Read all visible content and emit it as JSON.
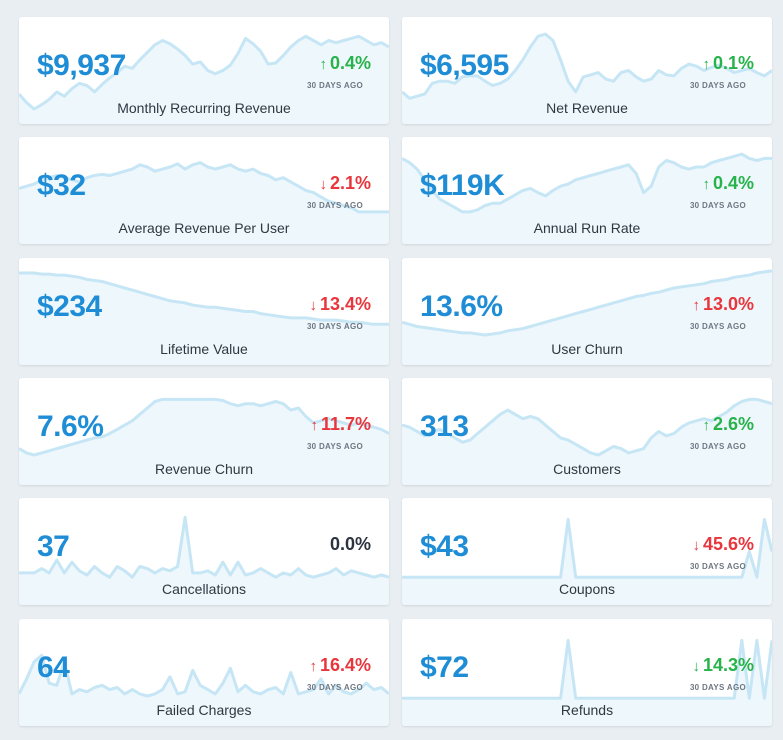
{
  "period_label": "30 DAYS AGO",
  "colors": {
    "value": "#1f8dd6",
    "positive": "#27b24a",
    "negative": "#e8363c",
    "neutral": "#2c3440",
    "spark_line": "#c6e6f5",
    "spark_fill": "#eef7fc"
  },
  "metrics": [
    {
      "title": "Monthly Recurring Revenue",
      "value": "$9,937",
      "change": "0.4%",
      "direction": "up",
      "status": "positive",
      "show_period": true,
      "trend": [
        0.72,
        0.8,
        0.86,
        0.82,
        0.77,
        0.7,
        0.74,
        0.67,
        0.62,
        0.64,
        0.7,
        0.63,
        0.57,
        0.52,
        0.46,
        0.48,
        0.4,
        0.33,
        0.26,
        0.22,
        0.25,
        0.3,
        0.36,
        0.44,
        0.42,
        0.5,
        0.53,
        0.5,
        0.45,
        0.34,
        0.2,
        0.25,
        0.32,
        0.44,
        0.43,
        0.36,
        0.28,
        0.22,
        0.18,
        0.22,
        0.26,
        0.22,
        0.24,
        0.22,
        0.2,
        0.18,
        0.22,
        0.26,
        0.24,
        0.28
      ]
    },
    {
      "title": "Net Revenue",
      "value": "$6,595",
      "change": "0.1%",
      "direction": "up",
      "status": "positive",
      "show_period": true,
      "trend": [
        0.7,
        0.76,
        0.74,
        0.72,
        0.62,
        0.6,
        0.6,
        0.62,
        0.56,
        0.55,
        0.55,
        0.6,
        0.64,
        0.62,
        0.58,
        0.5,
        0.4,
        0.28,
        0.18,
        0.16,
        0.22,
        0.4,
        0.6,
        0.7,
        0.56,
        0.54,
        0.52,
        0.58,
        0.6,
        0.52,
        0.5,
        0.56,
        0.6,
        0.58,
        0.5,
        0.54,
        0.55,
        0.48,
        0.44,
        0.46,
        0.5,
        0.47,
        0.45,
        0.48,
        0.52,
        0.5,
        0.48,
        0.52,
        0.55,
        0.5
      ]
    },
    {
      "title": "Average Revenue Per User",
      "value": "$32",
      "change": "2.1%",
      "direction": "down",
      "status": "negative",
      "show_period": true,
      "trend": [
        0.48,
        0.46,
        0.44,
        0.4,
        0.38,
        0.36,
        0.38,
        0.4,
        0.42,
        0.38,
        0.36,
        0.35,
        0.36,
        0.34,
        0.32,
        0.3,
        0.26,
        0.28,
        0.32,
        0.3,
        0.28,
        0.25,
        0.3,
        0.26,
        0.24,
        0.28,
        0.3,
        0.28,
        0.26,
        0.3,
        0.32,
        0.3,
        0.34,
        0.36,
        0.4,
        0.38,
        0.42,
        0.46,
        0.5,
        0.52,
        0.56,
        0.6,
        0.62,
        0.64,
        0.66,
        0.7,
        0.7,
        0.7,
        0.7,
        0.7
      ]
    },
    {
      "title": "Annual Run Rate",
      "value": "$119K",
      "change": "0.4%",
      "direction": "up",
      "status": "positive",
      "show_period": true,
      "trend": [
        0.2,
        0.24,
        0.3,
        0.4,
        0.5,
        0.58,
        0.62,
        0.66,
        0.7,
        0.7,
        0.68,
        0.64,
        0.62,
        0.62,
        0.58,
        0.54,
        0.5,
        0.48,
        0.52,
        0.55,
        0.5,
        0.46,
        0.44,
        0.4,
        0.38,
        0.36,
        0.34,
        0.32,
        0.3,
        0.28,
        0.26,
        0.34,
        0.52,
        0.46,
        0.28,
        0.22,
        0.24,
        0.28,
        0.3,
        0.28,
        0.28,
        0.24,
        0.22,
        0.2,
        0.18,
        0.16,
        0.2,
        0.22,
        0.2,
        0.2
      ]
    },
    {
      "title": "Lifetime Value",
      "value": "$234",
      "change": "13.4%",
      "direction": "down",
      "status": "negative",
      "show_period": true,
      "trend": [
        0.14,
        0.14,
        0.14,
        0.15,
        0.15,
        0.16,
        0.16,
        0.17,
        0.18,
        0.2,
        0.21,
        0.22,
        0.24,
        0.26,
        0.28,
        0.3,
        0.32,
        0.34,
        0.36,
        0.38,
        0.4,
        0.41,
        0.42,
        0.44,
        0.45,
        0.46,
        0.46,
        0.47,
        0.48,
        0.49,
        0.5,
        0.5,
        0.52,
        0.53,
        0.54,
        0.55,
        0.56,
        0.56,
        0.56,
        0.57,
        0.58,
        0.58,
        0.58,
        0.59,
        0.6,
        0.6,
        0.61,
        0.62,
        0.62,
        0.62
      ]
    },
    {
      "title": "User Churn",
      "value": "13.6%",
      "change": "13.0%",
      "direction": "up",
      "status": "negative",
      "show_period": true,
      "trend": [
        0.6,
        0.62,
        0.64,
        0.65,
        0.66,
        0.67,
        0.68,
        0.69,
        0.7,
        0.7,
        0.71,
        0.72,
        0.71,
        0.7,
        0.68,
        0.67,
        0.66,
        0.64,
        0.62,
        0.6,
        0.58,
        0.56,
        0.54,
        0.52,
        0.5,
        0.48,
        0.46,
        0.44,
        0.42,
        0.4,
        0.38,
        0.36,
        0.35,
        0.33,
        0.32,
        0.3,
        0.28,
        0.27,
        0.26,
        0.25,
        0.24,
        0.22,
        0.21,
        0.2,
        0.18,
        0.17,
        0.16,
        0.14,
        0.13,
        0.12
      ]
    },
    {
      "title": "Revenue Churn",
      "value": "7.6%",
      "change": "11.7%",
      "direction": "up",
      "status": "negative",
      "show_period": true,
      "trend": [
        0.66,
        0.7,
        0.72,
        0.7,
        0.68,
        0.66,
        0.64,
        0.62,
        0.6,
        0.58,
        0.56,
        0.55,
        0.52,
        0.48,
        0.44,
        0.4,
        0.34,
        0.28,
        0.22,
        0.2,
        0.2,
        0.2,
        0.2,
        0.2,
        0.2,
        0.2,
        0.2,
        0.21,
        0.24,
        0.26,
        0.24,
        0.24,
        0.26,
        0.24,
        0.22,
        0.24,
        0.3,
        0.28,
        0.36,
        0.42,
        0.4,
        0.38,
        0.4,
        0.42,
        0.44,
        0.42,
        0.44,
        0.46,
        0.48,
        0.52
      ]
    },
    {
      "title": "Customers",
      "value": "313",
      "change": "2.6%",
      "direction": "up",
      "status": "positive",
      "show_period": true,
      "trend": [
        0.44,
        0.46,
        0.5,
        0.54,
        0.5,
        0.48,
        0.52,
        0.56,
        0.6,
        0.58,
        0.52,
        0.46,
        0.4,
        0.34,
        0.3,
        0.34,
        0.38,
        0.36,
        0.38,
        0.44,
        0.5,
        0.56,
        0.58,
        0.62,
        0.66,
        0.7,
        0.72,
        0.68,
        0.64,
        0.66,
        0.7,
        0.68,
        0.66,
        0.56,
        0.5,
        0.54,
        0.52,
        0.46,
        0.42,
        0.4,
        0.38,
        0.4,
        0.36,
        0.32,
        0.26,
        0.22,
        0.2,
        0.2,
        0.22,
        0.24
      ]
    },
    {
      "title": "Cancellations",
      "value": "37",
      "change": "0.0%",
      "direction": "none",
      "status": "neutral",
      "show_period": false,
      "trend": [
        0.7,
        0.7,
        0.7,
        0.66,
        0.7,
        0.58,
        0.7,
        0.6,
        0.68,
        0.72,
        0.64,
        0.7,
        0.74,
        0.64,
        0.68,
        0.74,
        0.64,
        0.66,
        0.7,
        0.66,
        0.68,
        0.64,
        0.18,
        0.7,
        0.7,
        0.68,
        0.72,
        0.6,
        0.72,
        0.6,
        0.72,
        0.7,
        0.66,
        0.7,
        0.74,
        0.7,
        0.72,
        0.66,
        0.72,
        0.74,
        0.72,
        0.7,
        0.66,
        0.72,
        0.68,
        0.7,
        0.72,
        0.74,
        0.72,
        0.74
      ]
    },
    {
      "title": "Coupons",
      "value": "$43",
      "change": "45.6%",
      "direction": "down",
      "status": "negative",
      "show_period": true,
      "trend": [
        0.74,
        0.74,
        0.74,
        0.74,
        0.74,
        0.74,
        0.74,
        0.74,
        0.74,
        0.74,
        0.74,
        0.74,
        0.74,
        0.74,
        0.74,
        0.74,
        0.74,
        0.74,
        0.74,
        0.74,
        0.74,
        0.74,
        0.2,
        0.74,
        0.74,
        0.74,
        0.74,
        0.74,
        0.74,
        0.74,
        0.74,
        0.74,
        0.74,
        0.74,
        0.74,
        0.74,
        0.74,
        0.74,
        0.74,
        0.74,
        0.74,
        0.74,
        0.74,
        0.74,
        0.74,
        0.74,
        0.5,
        0.74,
        0.2,
        0.5
      ]
    },
    {
      "title": "Failed Charges",
      "value": "64",
      "change": "16.4%",
      "direction": "up",
      "status": "negative",
      "show_period": true,
      "trend": [
        0.7,
        0.56,
        0.4,
        0.34,
        0.6,
        0.62,
        0.4,
        0.7,
        0.66,
        0.68,
        0.64,
        0.62,
        0.66,
        0.64,
        0.7,
        0.66,
        0.7,
        0.72,
        0.7,
        0.66,
        0.54,
        0.7,
        0.68,
        0.48,
        0.62,
        0.66,
        0.7,
        0.6,
        0.46,
        0.68,
        0.62,
        0.68,
        0.7,
        0.66,
        0.64,
        0.7,
        0.5,
        0.7,
        0.68,
        0.66,
        0.56,
        0.7,
        0.62,
        0.68,
        0.7,
        0.66,
        0.6,
        0.66,
        0.64,
        0.7
      ]
    },
    {
      "title": "Refunds",
      "value": "$72",
      "change": "14.3%",
      "direction": "down",
      "status": "positive",
      "show_period": true,
      "trend": [
        0.74,
        0.74,
        0.74,
        0.74,
        0.74,
        0.74,
        0.74,
        0.74,
        0.74,
        0.74,
        0.74,
        0.74,
        0.74,
        0.74,
        0.74,
        0.74,
        0.74,
        0.74,
        0.74,
        0.74,
        0.74,
        0.74,
        0.2,
        0.74,
        0.74,
        0.74,
        0.74,
        0.74,
        0.74,
        0.74,
        0.74,
        0.74,
        0.74,
        0.74,
        0.74,
        0.74,
        0.74,
        0.74,
        0.74,
        0.74,
        0.74,
        0.74,
        0.74,
        0.74,
        0.74,
        0.2,
        0.74,
        0.2,
        0.74,
        0.2
      ]
    }
  ]
}
